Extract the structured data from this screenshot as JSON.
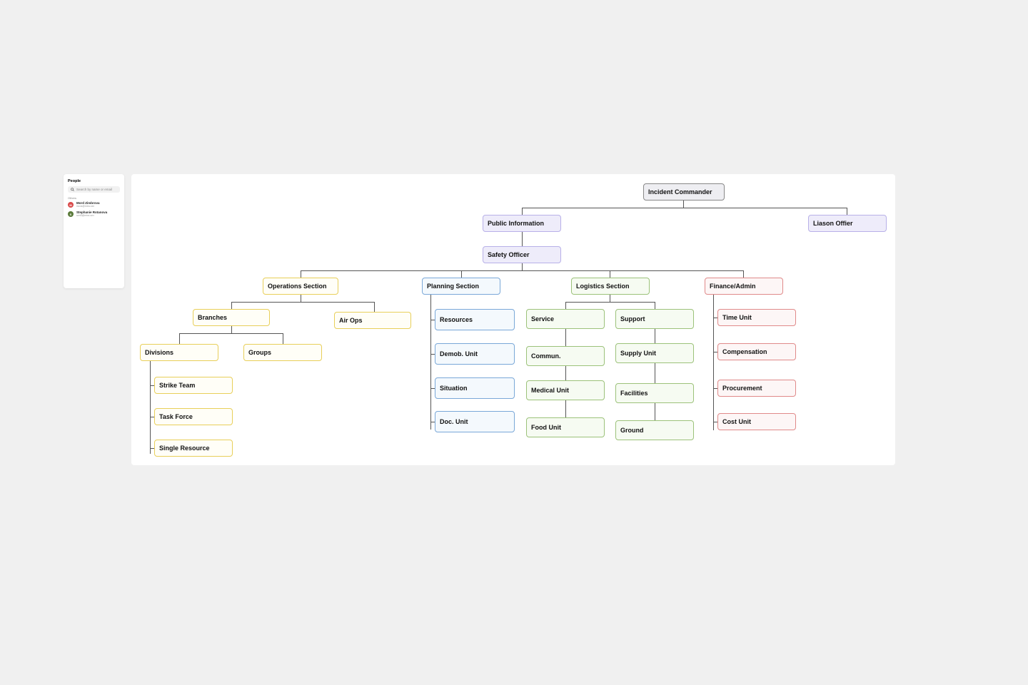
{
  "people_panel": {
    "title": "People",
    "search_placeholder": "Search by name or email",
    "section_label": "Others",
    "people": [
      {
        "name": "Mord Zimbrova",
        "email": "mzos@mira.xzn",
        "initial": "M",
        "avatar_color": "red"
      },
      {
        "name": "Stephanie Rotanova",
        "email": "sert3@mira.xzn",
        "initial": "S",
        "avatar_color": "green"
      }
    ]
  },
  "org_chart": {
    "root": "Incident Commander",
    "staff": {
      "public_info": "Public Information",
      "liaison": "Liason Offier",
      "safety": "Safety Officer"
    },
    "sections": {
      "operations": {
        "label": "Operations Section",
        "branches": "Branches",
        "air_ops": "Air Ops",
        "divisions": "Divisions",
        "groups": "Groups",
        "strike_team": "Strike Team",
        "task_force": "Task Force",
        "single_resource": "Single Resource"
      },
      "planning": {
        "label": "Planning Section",
        "resources": "Resources",
        "demob": "Demob. Unit",
        "situation": "Situation",
        "doc_unit": "Doc. Unit"
      },
      "logistics": {
        "label": "Logistics Section",
        "service": "Service",
        "support": "Support",
        "commun": "Commun.",
        "medical": "Medical Unit",
        "food": "Food Unit",
        "supply": "Supply Unit",
        "facilities": "Facilities",
        "ground": "Ground"
      },
      "finance": {
        "label": "Finance/Admin",
        "time_unit": "Time Unit",
        "compensation": "Compensation",
        "procurement": "Procurement",
        "cost_unit": "Cost Unit"
      }
    }
  },
  "colors": {
    "gray": "#888888",
    "lavender": "#b8b0e8",
    "yellow": "#e8cf5a",
    "blue": "#7aa8d8",
    "green": "#9cc27a",
    "red": "#e08a8a"
  }
}
